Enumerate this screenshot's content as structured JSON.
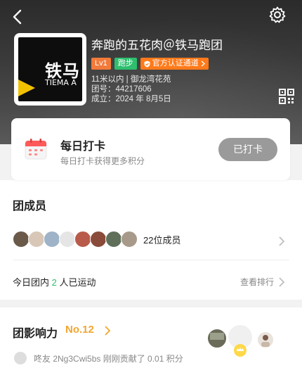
{
  "club": {
    "name": "奔跑的五花肉＠铁马跑团",
    "logo_text_cn": "铁马",
    "logo_text_en": "TIEMA A",
    "tags": {
      "level": "Lv1",
      "sport": "跑步",
      "official": "官方认证通道"
    },
    "distance_location": "11米以内 | 御龙湾花苑",
    "team_id": "团号：44217606",
    "founded": "成立：2024 年 8月5日"
  },
  "checkin": {
    "title": "每日打卡",
    "subtitle": "每日打卡获得更多积分",
    "button_label": "已打卡"
  },
  "members": {
    "title": "团成员",
    "count_label": "22位成员",
    "avatar_colors": [
      "#6b5a4a",
      "#d8c7b6",
      "#9fb3c8",
      "#e5e5e5",
      "#b85b4a",
      "#8a4b3a",
      "#5f6f5a",
      "#a89a8a"
    ],
    "active_prefix": "今日团内 ",
    "active_count": "2",
    "active_suffix": " 人已运动",
    "rank_link": "查看排行"
  },
  "influence": {
    "title": "团影响力",
    "rank": "No.12",
    "feed": "咚友 2Ng3Cwi5bs 刚刚贡献了 0.01 积分"
  },
  "colors": {
    "accent_green": "#2dbf6e",
    "accent_orange": "#ff7a1a",
    "rank_gold": "#f2a630"
  }
}
